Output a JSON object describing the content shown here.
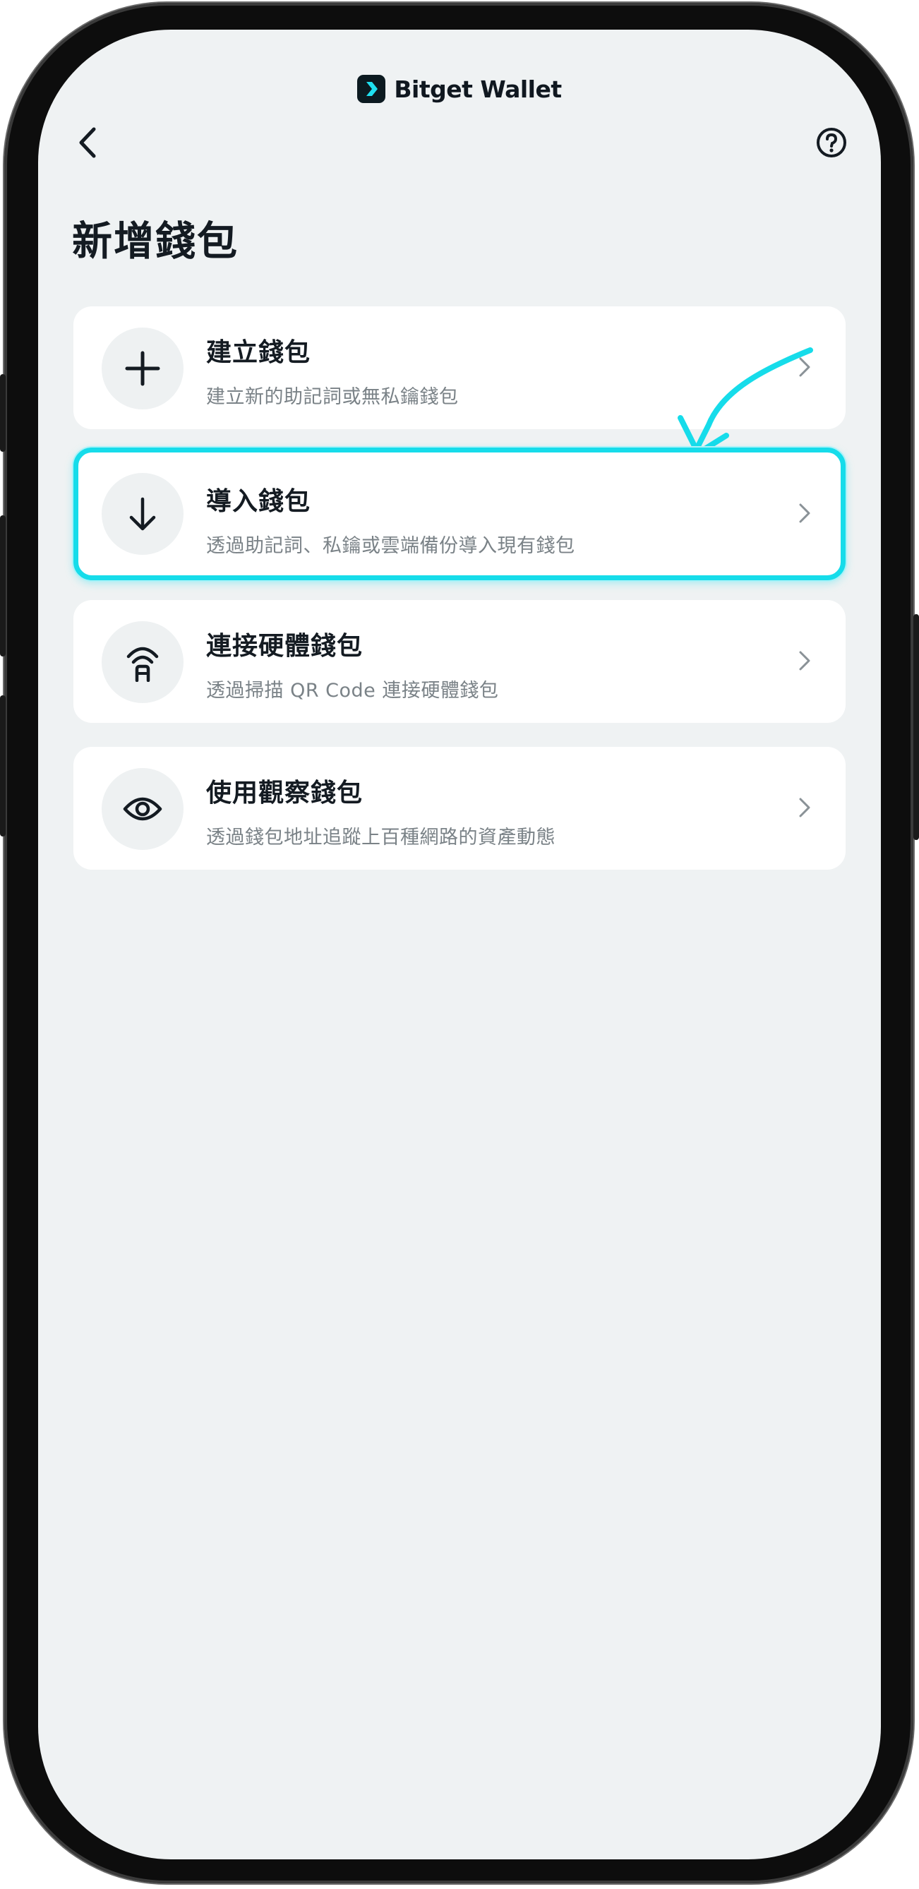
{
  "header": {
    "brand_name": "Bitget Wallet",
    "brand_icon": "bitget-logo-icon",
    "back_icon": "back-chevron-icon",
    "help_icon": "help-circle-icon"
  },
  "page": {
    "title": "新增錢包"
  },
  "options": [
    {
      "title": "建立錢包",
      "description": "建立新的助記詞或無私鑰錢包",
      "icon": "plus-icon"
    },
    {
      "title": "導入錢包",
      "description": "透過助記詞、私鑰或雲端備份導入現有錢包",
      "icon": "arrow-down-icon"
    },
    {
      "title": "連接硬體錢包",
      "description": "透過掃描 QR Code 連接硬體錢包",
      "icon": "hardware-wallet-icon"
    },
    {
      "title": "使用觀察錢包",
      "description": "透過錢包地址追蹤上百種網路的資產動態",
      "icon": "eye-icon"
    }
  ],
  "colors": {
    "highlight": "#16dcea",
    "background": "#eff2f3",
    "card": "#ffffff",
    "title_text": "#141b22",
    "desc_text": "#7a8287"
  }
}
